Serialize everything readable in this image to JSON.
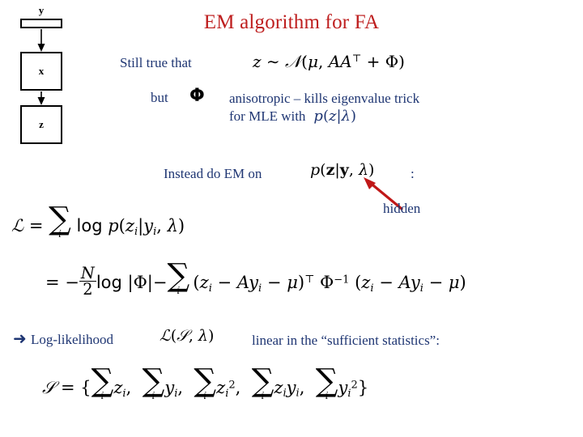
{
  "slide": {
    "title": "EM algorithm for FA",
    "title_color": "#BE1E1E",
    "body_color": "#1F3673",
    "background": "#FFFFFF"
  },
  "chain_diagram": {
    "nodes": [
      {
        "label": "y",
        "shape": "flat-bar"
      },
      {
        "label": "x",
        "shape": "square"
      },
      {
        "label": "z",
        "shape": "square"
      }
    ],
    "edges": [
      "y-to-x",
      "x-to-z"
    ]
  },
  "lines": {
    "still_true": "Still true that",
    "but": "but",
    "phi": "Φ",
    "anisotropic": "anisotropic – kills eigenvalue trick",
    "for_mle_with": "for MLE with",
    "instead": "Instead do EM on",
    "colon": ":",
    "hidden": "hidden",
    "loglikelihood": "Log-likelihood",
    "linear_in": "linear in the “sufficient statistics”:",
    "bullet": "➜"
  },
  "equations": {
    "z_dist": {
      "lhs": "z",
      "rel": "∼",
      "dist": "ℕ",
      "mean": "μ",
      "cov_A": "AA",
      "cov_transpose": "⊤",
      "plus": "+",
      "cov_phi": "Φ"
    },
    "p_z_given_lambda": {
      "p": "p",
      "z": "z",
      "bar": "|",
      "lambda": "λ"
    },
    "p_z_given_y_lambda": {
      "p": "p",
      "z": "z",
      "bar": "|",
      "y": "y",
      "comma": ",",
      "lambda": "λ"
    },
    "likelihood_line1": {
      "L": "ℒ",
      "eq": "=",
      "sum": "∑",
      "index": "i",
      "log": "log",
      "p": "p",
      "z_i": "z",
      "sub_i": "i",
      "bar": "|",
      "y_i": "y",
      "lambda": "λ"
    },
    "likelihood_line2": {
      "eq": "=",
      "minus": "−",
      "N": "N",
      "two": "2",
      "log": "log",
      "absphi": "|Φ|",
      "sum": "∑",
      "index": "i",
      "z_i": "z",
      "A": "A",
      "y_i": "y",
      "mu": "μ",
      "transpose": "⊤",
      "phi_inv_base": "Φ",
      "phi_inv_exp": "−1"
    },
    "L_of_S_lambda": {
      "L": "ℒ",
      "S": "𝒮",
      "lambda": "λ"
    },
    "sufficient_statistics": {
      "S": "𝒮",
      "eq": "=",
      "open": "{",
      "close": "}",
      "terms": [
        {
          "sum": "∑",
          "index": "i",
          "body": "z",
          "sub": "i",
          "pow": ""
        },
        {
          "sum": "∑",
          "index": "i",
          "body": "y",
          "sub": "i",
          "pow": ""
        },
        {
          "sum": "∑",
          "index": "i",
          "body": "z",
          "sub": "i",
          "pow": "2"
        },
        {
          "sum": "∑",
          "index": "i",
          "body": "zy",
          "sub": "i",
          "pow": ""
        },
        {
          "sum": "∑",
          "index": "i",
          "body": "y",
          "sub": "i",
          "pow": "2"
        }
      ]
    }
  },
  "annotations": {
    "red_arrow": {
      "color": "#C01818",
      "points_to": "y in p(z|y,lambda)",
      "label": "hidden"
    }
  }
}
